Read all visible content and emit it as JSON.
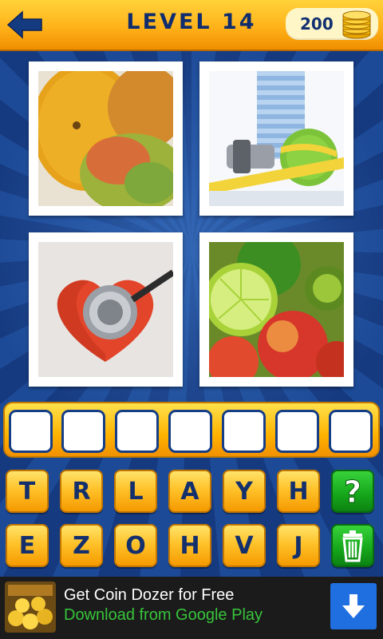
{
  "header": {
    "title": "LEVEL 14",
    "coins": "200",
    "back_icon": "back-arrow-icon",
    "coin_icon": "coin-stack-icon"
  },
  "puzzle": {
    "images": [
      "melon-and-mango",
      "water-bottle-dumbbell-apple-tape-measure",
      "heart-with-stethoscope",
      "lime-apples-kiwi-fruits"
    ],
    "answer_slots": 7
  },
  "keyboard": {
    "row1": [
      "T",
      "R",
      "L",
      "A",
      "Y",
      "H"
    ],
    "row2": [
      "E",
      "Z",
      "O",
      "H",
      "V",
      "J"
    ],
    "hint_icon": "question-mark-icon",
    "delete_icon": "trash-icon"
  },
  "ad": {
    "title": "Get Coin Dozer for Free",
    "subtitle": "Download from Google Play",
    "download_icon": "download-arrow-icon"
  },
  "colors": {
    "header_orange": "#ffb21a",
    "title_navy": "#0f2d6e",
    "background_blue": "#1b3f88",
    "key_orange": "#ffc22a",
    "green_button": "#15a51a",
    "ad_green_text": "#37c43b",
    "ad_button_blue": "#1f6fe0"
  }
}
